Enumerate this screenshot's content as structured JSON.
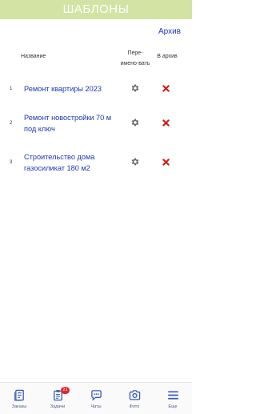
{
  "header": {
    "title": "ШАБЛОНЫ"
  },
  "archive_link": "Архив",
  "columns": {
    "name": "Название",
    "rename": "Пере-имено-вать",
    "archive": "В архив"
  },
  "rows": [
    {
      "num": "1",
      "title": "Ремонт квартиры 2023"
    },
    {
      "num": "2",
      "title": "Ремонт новостройки 70 м под ключ"
    },
    {
      "num": "3",
      "title": "Строительство дома газосиликат 180 м2"
    }
  ],
  "tabs": [
    {
      "label": "Заказы",
      "icon": "orders-icon"
    },
    {
      "label": "Задачи",
      "icon": "tasks-icon",
      "badge": "21"
    },
    {
      "label": "Чаты",
      "icon": "chat-icon"
    },
    {
      "label": "Фото",
      "icon": "camera-icon"
    },
    {
      "label": "Еще",
      "icon": "menu-icon"
    }
  ],
  "colors": {
    "header_bg": "#d3e3a4",
    "link": "#1f37b8",
    "delete": "#d11a1a",
    "badge": "#e0262c",
    "tab_icon": "#3b5cb8"
  }
}
